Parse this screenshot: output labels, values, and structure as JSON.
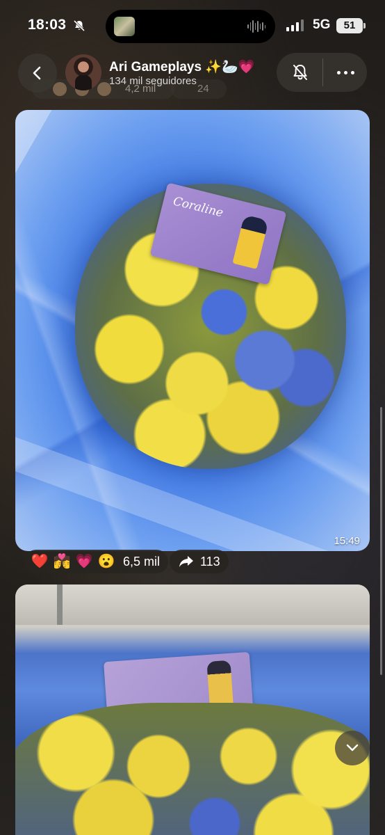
{
  "status_bar": {
    "time": "18:03",
    "network": "5G",
    "battery": "51"
  },
  "header": {
    "page_name": "Ari Gameplays",
    "name_emojis": "✨🦢💗",
    "followers": "134 mil seguidores",
    "behind_reaction_count": "4,2 mil",
    "behind_share_count": "24"
  },
  "posts": [
    {
      "timestamp": "15:49",
      "ticket_text": "Coraline"
    }
  ],
  "reactions": {
    "emojis": [
      "❤️",
      "💏",
      "💗",
      "😮"
    ],
    "count": "6,5 mil",
    "shares": "113"
  }
}
